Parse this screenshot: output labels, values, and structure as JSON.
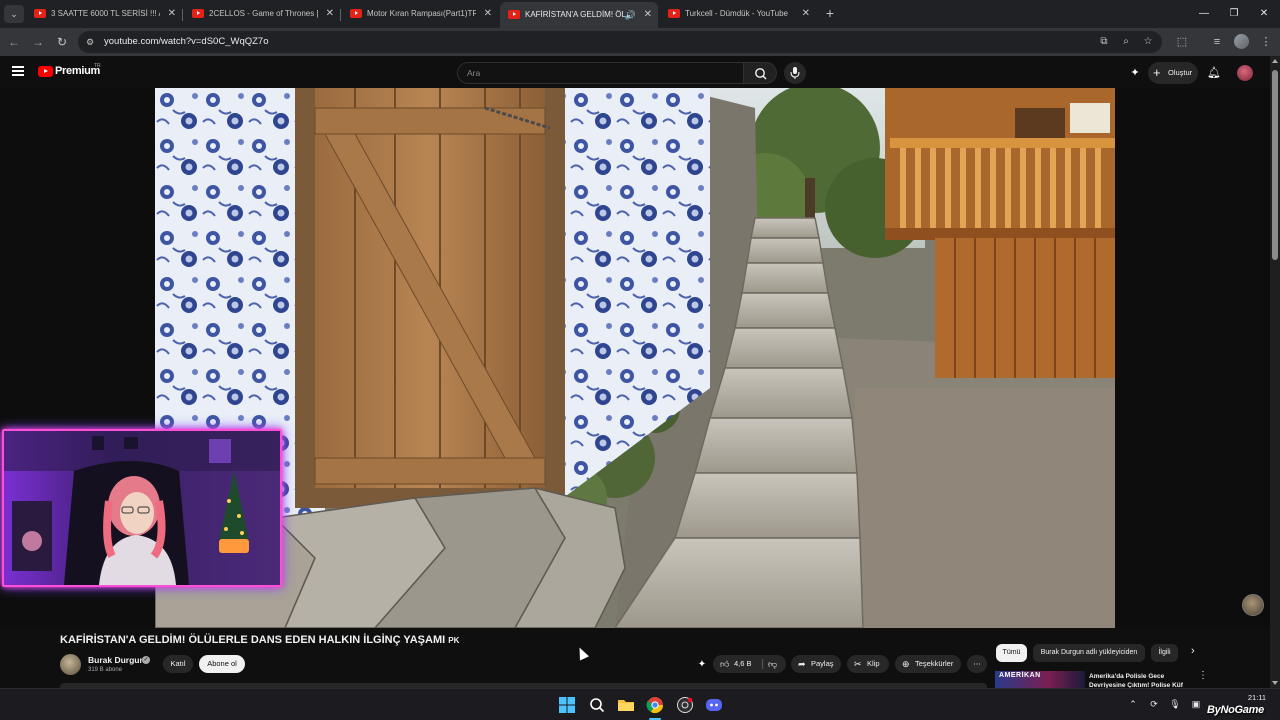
{
  "browser": {
    "tabs": [
      {
        "title": "3 SAATTE 6000 TL SERİSİ !!! AD",
        "active": false
      },
      {
        "title": "2CELLOS - Game of Thrones [LI",
        "active": false
      },
      {
        "title": "Motor Kıran Rampası(Part1)TR",
        "active": false
      },
      {
        "title": "KAFİRİSTAN'A GELDİM! ÖLÜ",
        "active": true,
        "audio": true
      },
      {
        "title": "Turkcell - Dümdük - YouTube",
        "active": false
      }
    ],
    "url": "youtube.com/watch?v=dS0C_WqQZ7o"
  },
  "youtube": {
    "brand": "Premium",
    "brand_country": "TR",
    "search_placeholder": "Ara",
    "create_label": "Oluştur"
  },
  "video": {
    "title": "KAFİRİSTAN'A GELDİM! ÖLÜLERLE DANS EDEN HALKIN İLGİNÇ YAŞAMI",
    "title_flag": "PK",
    "channel": "Burak Durgun",
    "subscribers": "319 B abone",
    "join_label": "Katıl",
    "subscribe_label": "Abone ol",
    "likes": "4,6 B",
    "share_label": "Paylaş",
    "clip_label": "Klip",
    "thanks_label": "Teşekkürler"
  },
  "sidebar": {
    "chips": [
      "Tümü",
      "Burak Durgun adlı yükleyiciden",
      "İlgili"
    ],
    "recommended": {
      "thumb_text": "AMERİKAN",
      "title": "Amerika'da Polisle Gece Devriyesine Çıktım! Polise Küf"
    }
  },
  "taskbar": {
    "time": "21:11"
  },
  "watermark": "ByNoGame",
  "colors": {
    "youtube_red": "#ff0000",
    "webcam_border": "#ff4fd8",
    "background": "#0f0f0f"
  }
}
